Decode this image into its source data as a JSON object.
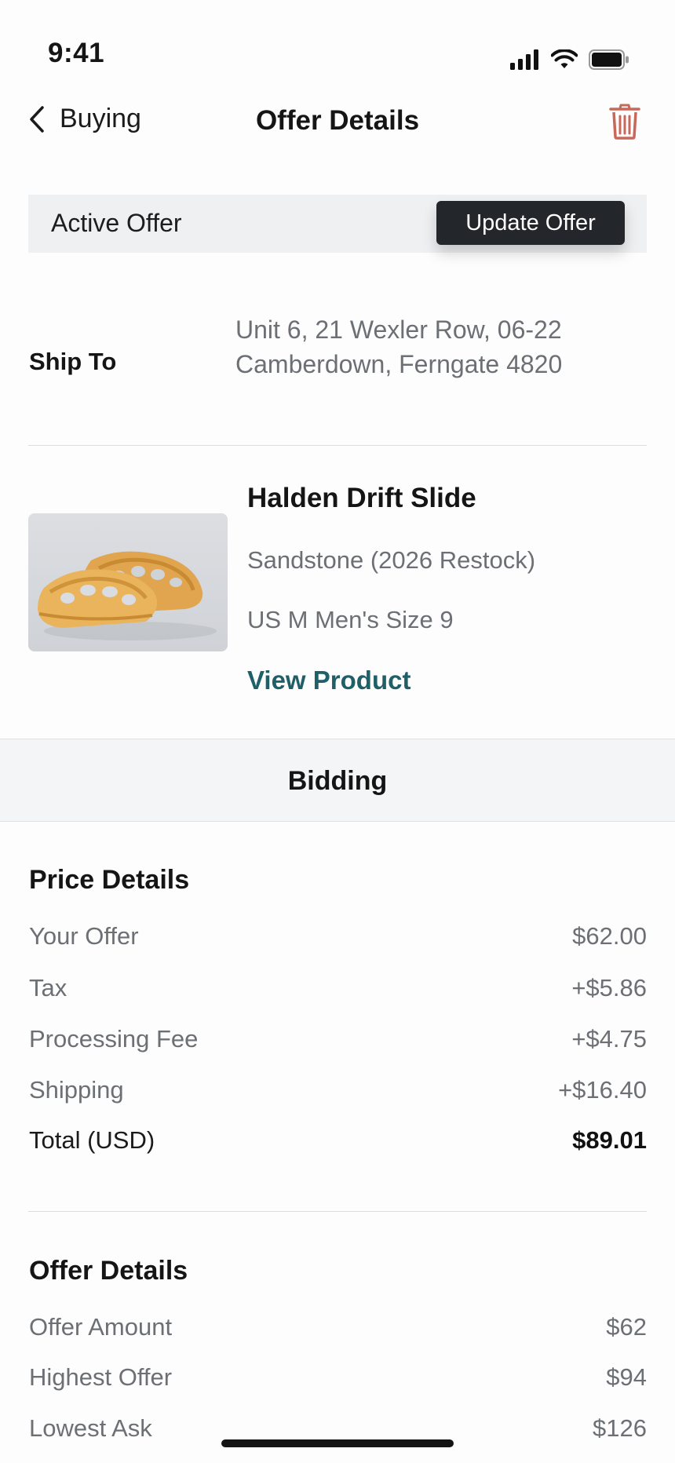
{
  "status_bar": {
    "time": "9:41"
  },
  "nav": {
    "back_label": "Buying",
    "title": "Offer Details"
  },
  "banner": {
    "label": "Active Offer",
    "button_label": "Update Offer"
  },
  "ship_to": {
    "label": "Ship To",
    "address_line1": "Unit 6, 21 Wexler Row, 06-22",
    "address_line2": "Camberdown, Ferngate 4820"
  },
  "product": {
    "name": "Halden Drift Slide",
    "colorway": "Sandstone (2026 Restock)",
    "size": "US M Men's Size 9",
    "link_label": "View Product"
  },
  "bidding": {
    "label": "Bidding"
  },
  "price_details": {
    "title": "Price Details",
    "rows": [
      {
        "label": "Your Offer",
        "value": "$62.00"
      },
      {
        "label": "Tax",
        "value": "+$5.86"
      },
      {
        "label": "Processing Fee",
        "value": "+$4.75"
      },
      {
        "label": "Shipping",
        "value": "+$16.40"
      },
      {
        "label": "Total (USD)",
        "value": "$89.01"
      }
    ]
  },
  "offer_details": {
    "title": "Offer Details",
    "rows": [
      {
        "label": "Offer Amount",
        "value": "$62"
      },
      {
        "label": "Highest Offer",
        "value": "$94"
      },
      {
        "label": "Lowest Ask",
        "value": "$126"
      }
    ]
  },
  "colors": {
    "accent_link": "#1f5f68",
    "trash": "#c8685b",
    "button_bg": "#23262a"
  }
}
